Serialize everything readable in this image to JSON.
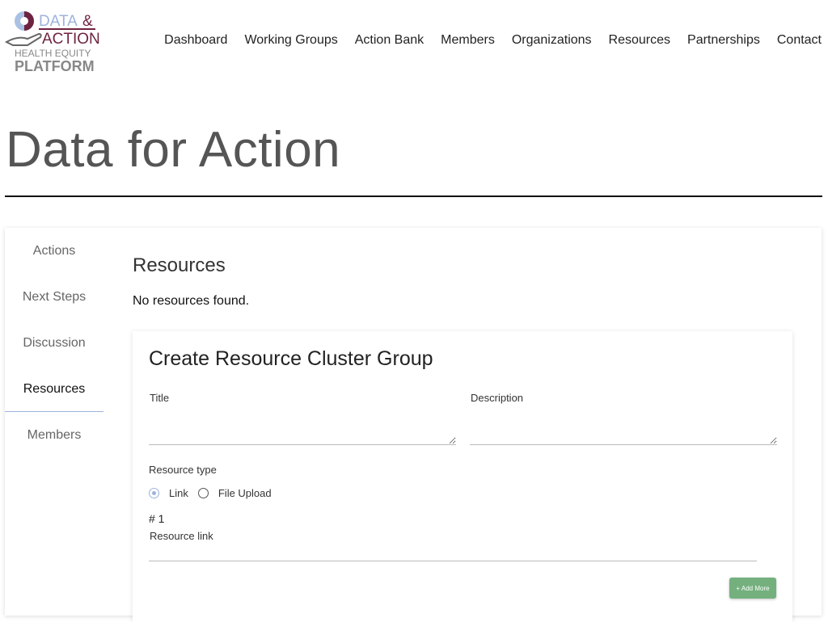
{
  "logo": {
    "line1": "DATA&",
    "line2": "ACTION",
    "line3": "HEALTH EQUITY",
    "line4": "PLATFORM"
  },
  "nav": [
    "Dashboard",
    "Working Groups",
    "Action Bank",
    "Members",
    "Organizations",
    "Resources",
    "Partnerships",
    "Contact"
  ],
  "page_title": "Data for Action",
  "sidebar": [
    {
      "label": "Actions"
    },
    {
      "label": "Next Steps"
    },
    {
      "label": "Discussion"
    },
    {
      "label": "Resources",
      "active": true
    },
    {
      "label": "Members"
    }
  ],
  "section": {
    "title": "Resources",
    "empty": "No resources found."
  },
  "form": {
    "title": "Create Resource Cluster Group",
    "title_label": "Title",
    "title_value": "",
    "description_label": "Description",
    "description_value": "",
    "resource_type_label": "Resource type",
    "options": [
      "Link",
      "File Upload"
    ],
    "selected": "Link",
    "item_number": "# 1",
    "resource_link_label": "Resource link",
    "resource_link_value": "",
    "add_more": "+ Add More"
  },
  "colors": {
    "accent": "#9db3dd",
    "button": "#74b07e",
    "brand_maroon": "#6e2340"
  }
}
